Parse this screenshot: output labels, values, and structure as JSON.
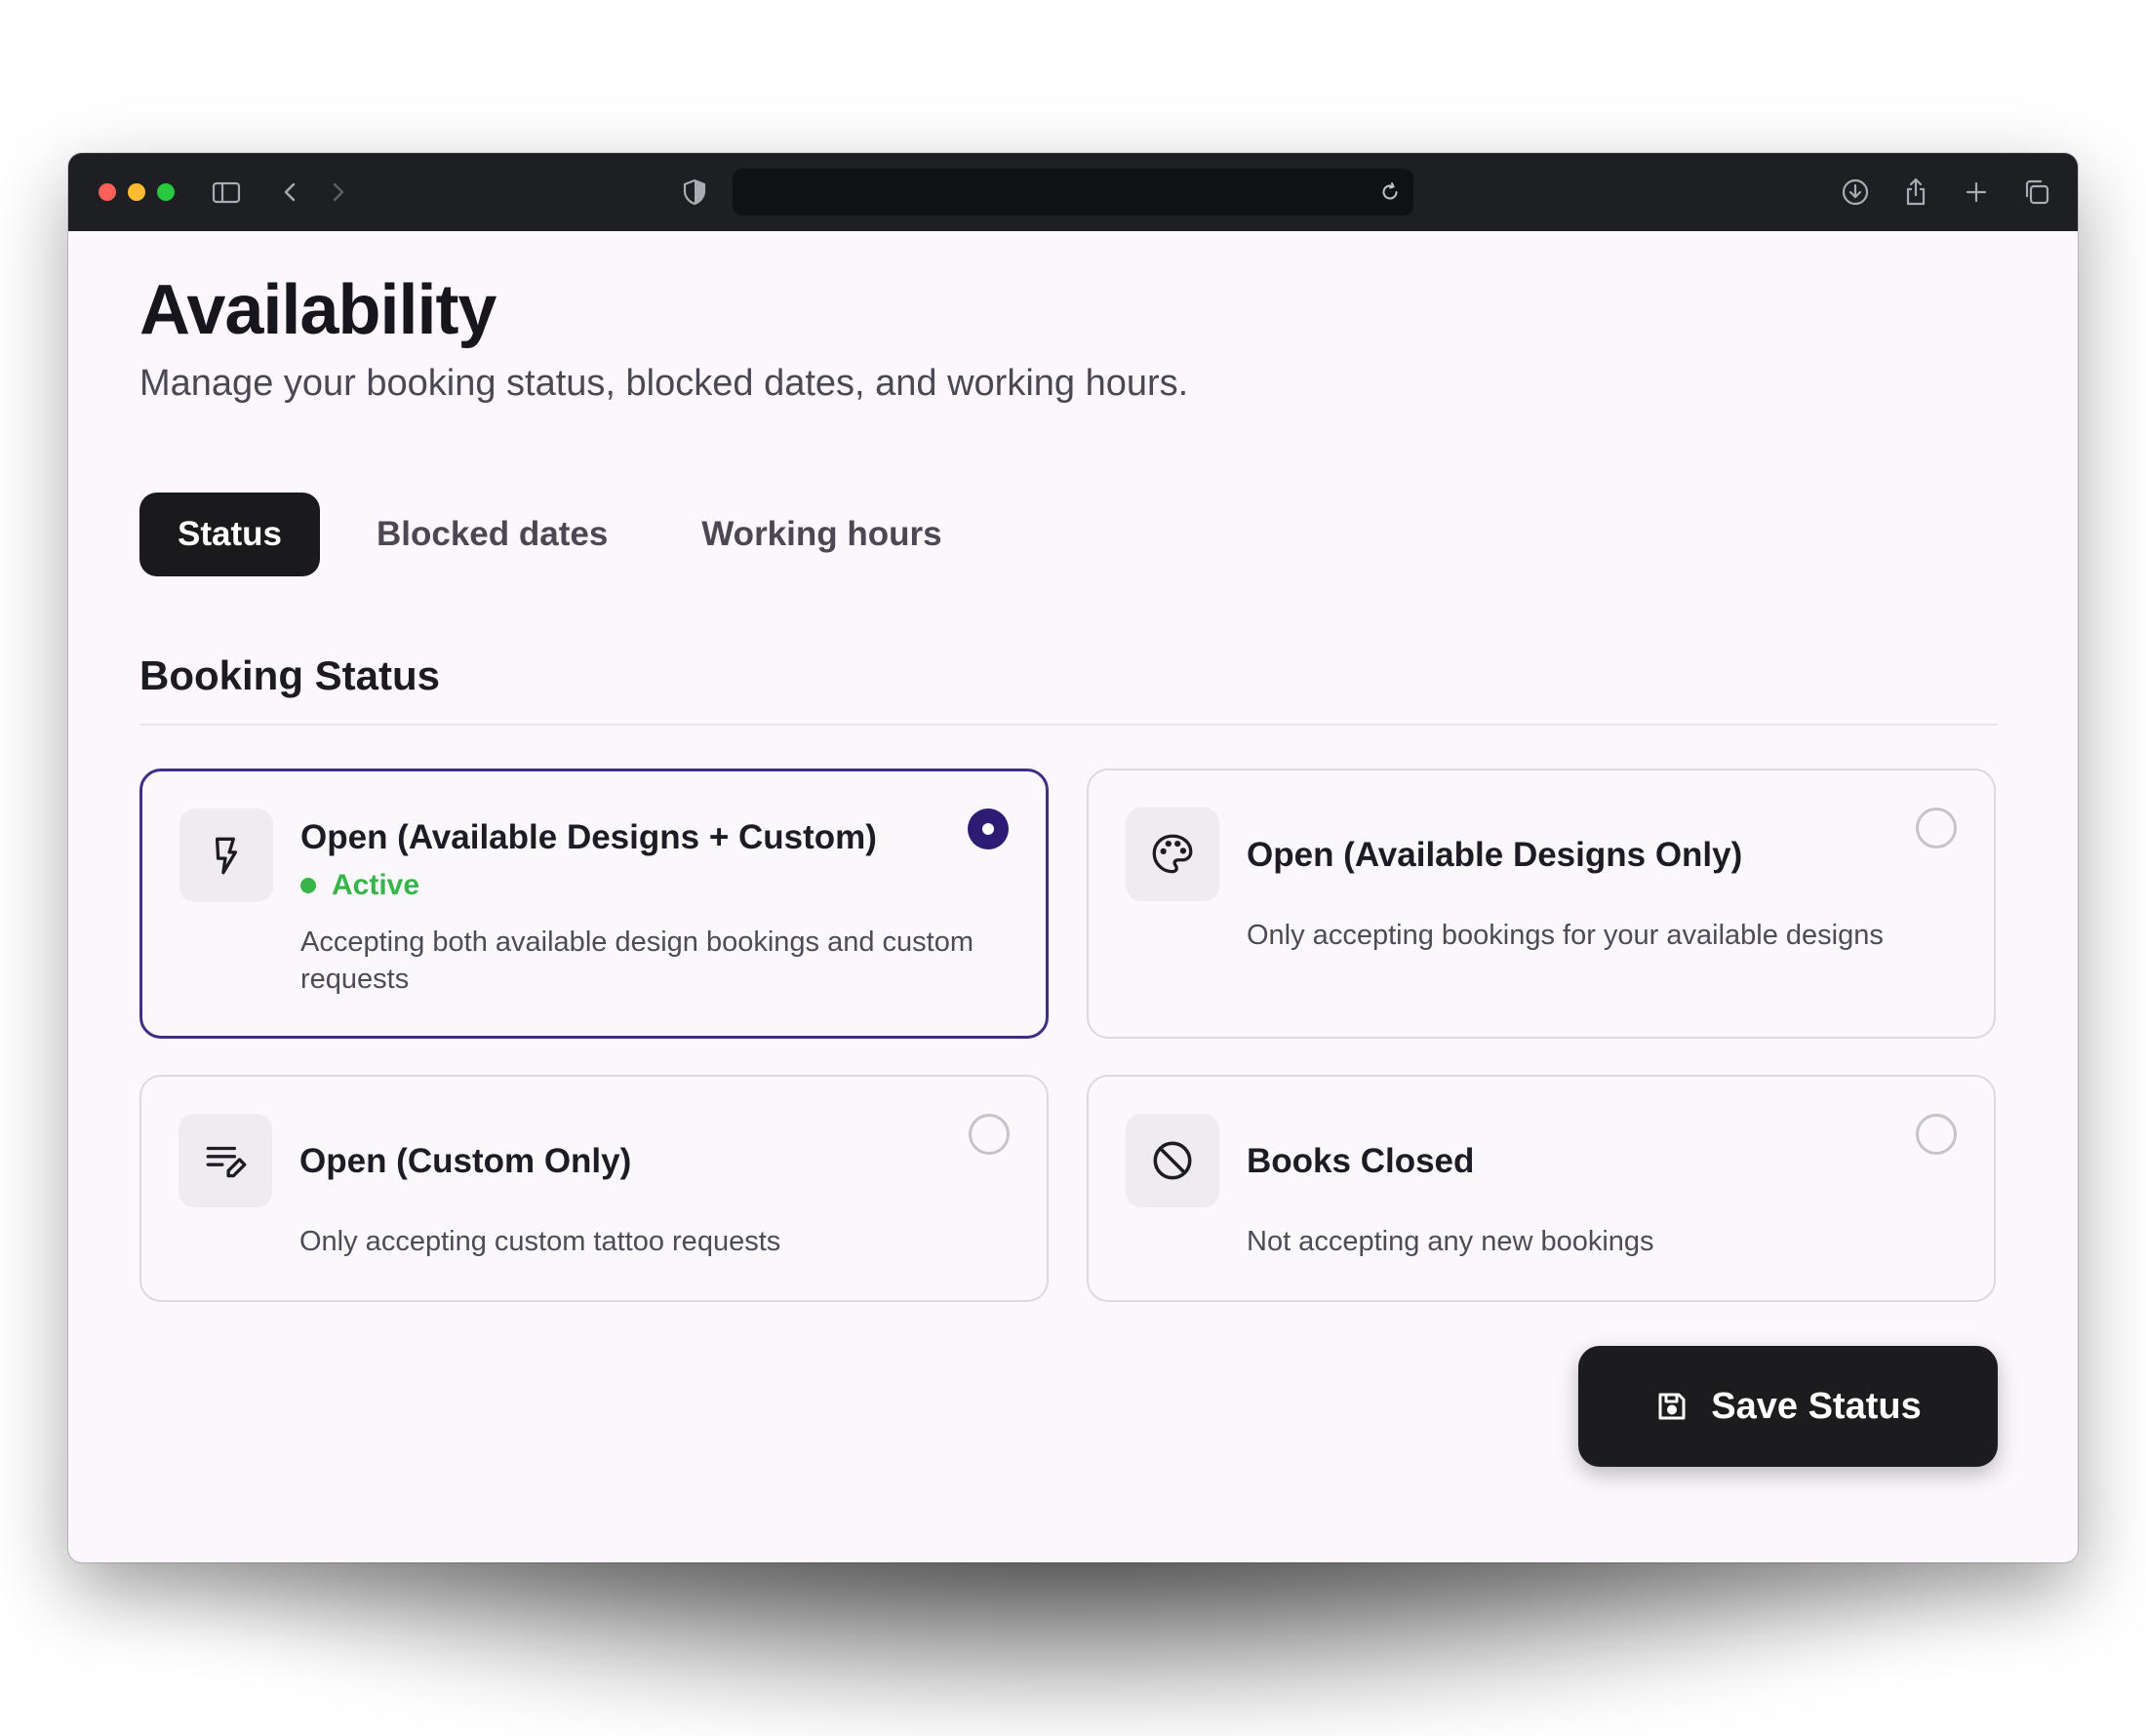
{
  "browser": {
    "address": "",
    "icons": [
      "sidebar-icon",
      "back-icon",
      "forward-icon",
      "shield-icon",
      "reload-icon",
      "download-icon",
      "share-icon",
      "new-tab-icon",
      "tabs-overview-icon"
    ]
  },
  "page": {
    "title": "Availability",
    "subtitle": "Manage your booking status, blocked dates, and working hours."
  },
  "tabs": [
    {
      "label": "Status",
      "active": true
    },
    {
      "label": "Blocked dates",
      "active": false
    },
    {
      "label": "Working hours",
      "active": false
    }
  ],
  "section": {
    "title": "Booking Status"
  },
  "options": [
    {
      "title": "Open (Available Designs + Custom)",
      "badge": "Active",
      "description": "Accepting both available design bookings and custom requests",
      "icon": "bolt-icon",
      "selected": true
    },
    {
      "title": "Open (Available Designs Only)",
      "badge": "",
      "description": "Only accepting bookings for your available designs",
      "icon": "palette-icon",
      "selected": false
    },
    {
      "title": "Open (Custom Only)",
      "badge": "",
      "description": "Only accepting custom tattoo requests",
      "icon": "edit-list-icon",
      "selected": false
    },
    {
      "title": "Books Closed",
      "badge": "",
      "description": "Not accepting any new bookings",
      "icon": "block-icon",
      "selected": false
    }
  ],
  "save_button": {
    "label": "Save Status",
    "icon": "save-icon"
  },
  "colors": {
    "accent": "#2c1c74",
    "active": "#38b54a",
    "dark": "#1c1c1e",
    "background": "#fbf7fc"
  }
}
